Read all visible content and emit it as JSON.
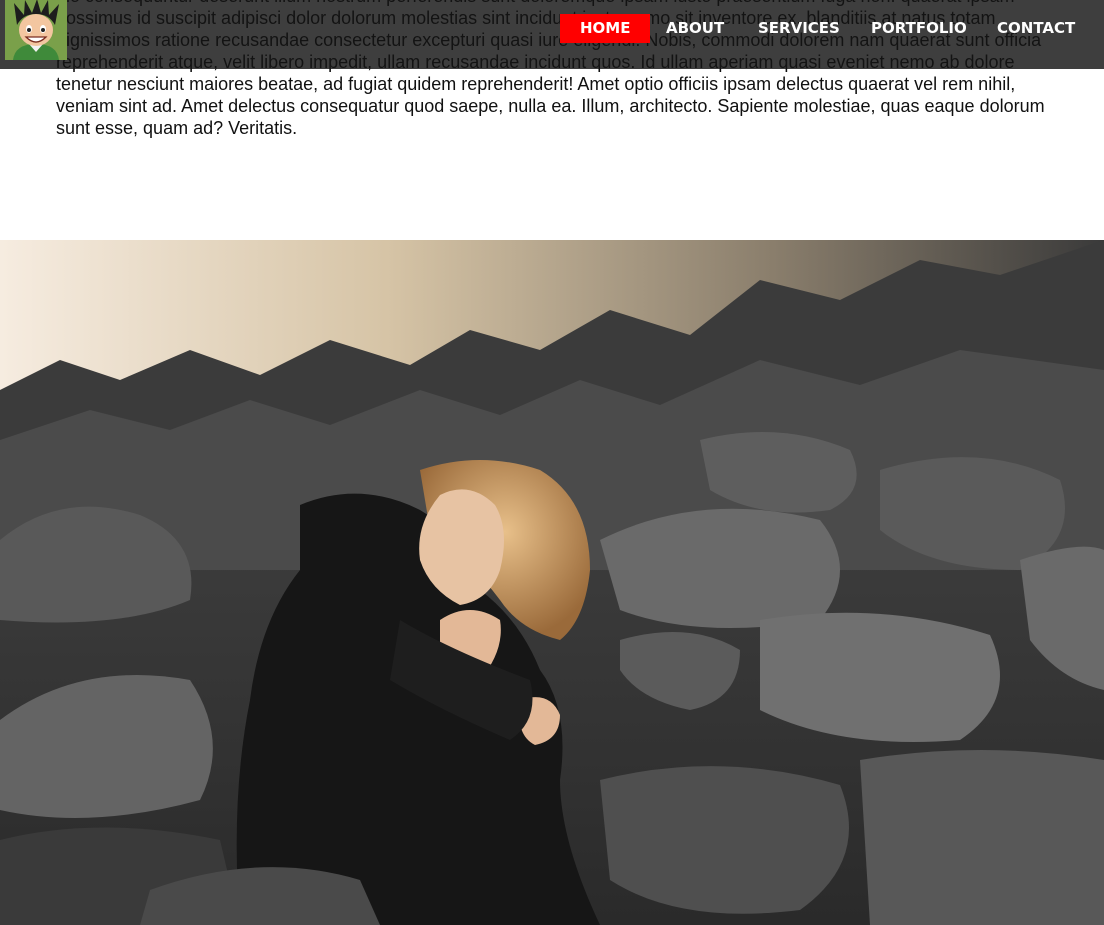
{
  "article": {
    "text": "dio consequuntur deserunt illum nostrum perferendis sunt doloremque ipsam iusto praesentium fuga non. quaerat ipsam possimus id suscipit adipisci dolor dolorum molestias sint incidunt iusto nemo sit inventore ex, blanditiis at natus totam dignissimos ratione recusandae consectetur excepturi quasi iure eligendi. Nobis, commodi dolorem nam quaerat sunt officia reprehenderit atque, velit libero impedit, ullam recusandae incidunt quos. Id ullam aperiam quasi eveniet nemo ab dolore tenetur nesciunt maiores beatae, ad fugiat quidem reprehenderit! Amet optio officiis ipsam delectus quaerat vel rem nihil, veniam sint ad. Amet delectus consequatur quod saepe, nulla ea. Illum, architecto. Sapiente molestiae, quas eaque dolorum sunt esse, quam ad? Veritatis."
  },
  "nav": {
    "items": [
      {
        "label": "HOME",
        "active": true
      },
      {
        "label": "ABOUT",
        "active": false
      },
      {
        "label": "SERVICES",
        "active": false
      },
      {
        "label": "PORTFOLIO",
        "active": false
      },
      {
        "label": "CONTACT",
        "active": false
      }
    ]
  },
  "colors": {
    "nav_background": "#141414",
    "active_tab": "#ff0000",
    "nav_text": "#ffffff",
    "body_text": "#111111"
  }
}
